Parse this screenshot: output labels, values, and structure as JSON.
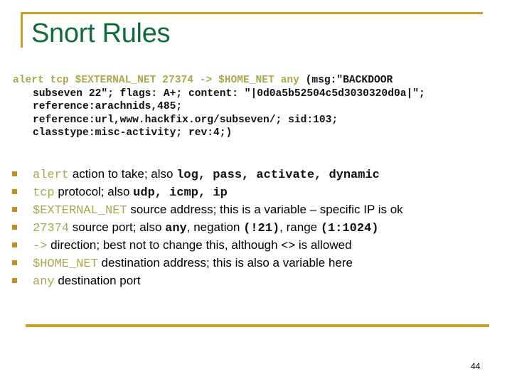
{
  "slide": {
    "title": "Snort Rules",
    "page_number": "44",
    "colors": {
      "accent_rule": "#C8A028",
      "title": "#0F6B3C",
      "highlight": "#A9A84E",
      "bullet": "#C09020"
    }
  },
  "rule": {
    "header_highlight": "alert tcp $EXTERNAL_NET 27374 -> $HOME_NET any",
    "header_rest": " (msg:\"BACKDOOR",
    "lines": [
      "subseven 22\"; flags: A+; content: \"|0d0a5b52504c5d3030320d0a|\";",
      "reference:arachnids,485;",
      "reference:url,www.hackfix.org/subseven/; sid:103;",
      "classtype:misc-activity; rev:4;)"
    ]
  },
  "bullets": [
    {
      "keyword": "alert",
      "text": " action to take; also ",
      "mono": "log, pass, activate, dynamic"
    },
    {
      "keyword": "tcp",
      "text": " protocol; also ",
      "mono": "udp, icmp, ip"
    },
    {
      "keyword": "$EXTERNAL_NET",
      "text": " source address; this is a variable – specific IP is ok"
    },
    {
      "keyword": "27374",
      "text": " source port; also ",
      "mono": "any",
      "text2": ", negation ",
      "mono2": "(!21)",
      "text3": ", range ",
      "mono3": "(1:1024)"
    },
    {
      "keyword": "->",
      "text": " direction; best not to change this, although <>  is allowed"
    },
    {
      "keyword": "$HOME_NET",
      "text": " destination address; this is also a variable here"
    },
    {
      "keyword": "any",
      "text": " destination port"
    }
  ]
}
